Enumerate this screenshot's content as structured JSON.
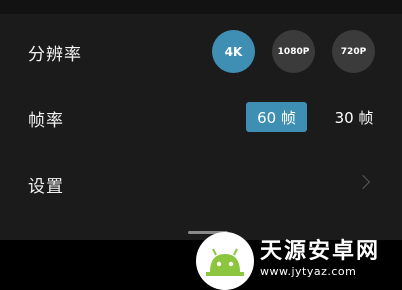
{
  "settings": {
    "resolution": {
      "label": "分辨率",
      "options": [
        "4K",
        "1080P",
        "720P"
      ],
      "selected": "4K"
    },
    "frame_rate": {
      "label": "帧率",
      "options": [
        "60 帧",
        "30 帧"
      ],
      "selected": "60 帧"
    },
    "more": {
      "label": "设置"
    }
  },
  "watermark": {
    "name": "天源安卓网",
    "url": "www.jytyaz.com"
  },
  "colors": {
    "accent": "#3e8fb3",
    "panel": "#1b1b1b",
    "background": "#000000"
  }
}
